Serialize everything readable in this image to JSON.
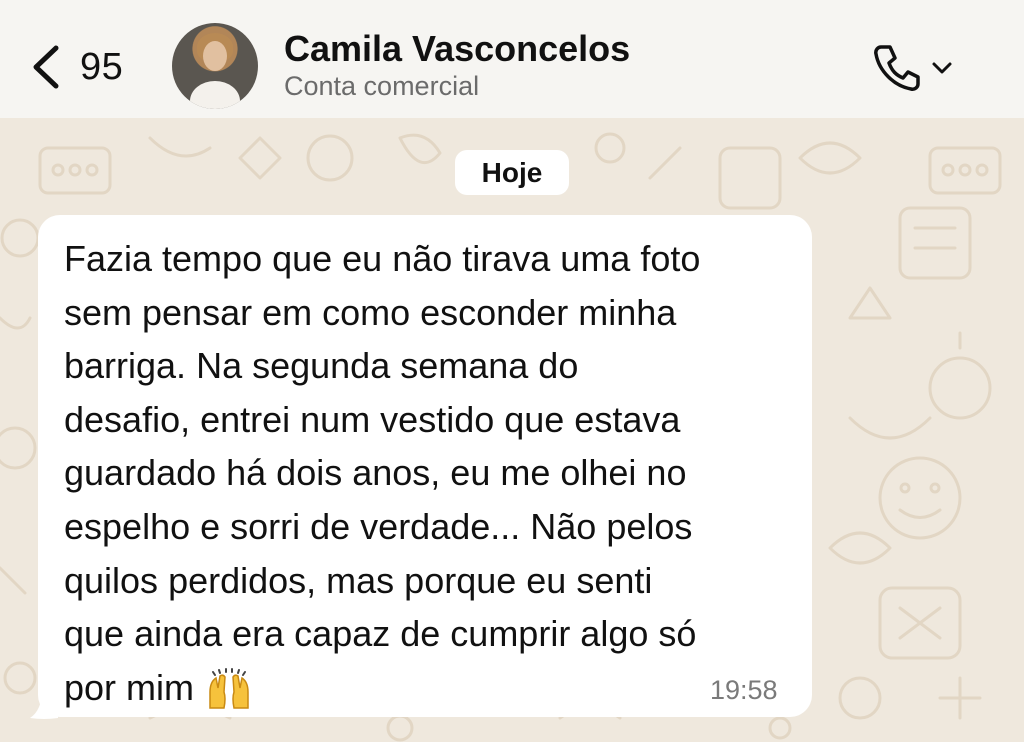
{
  "header": {
    "back_count": "95",
    "contact_name": "Camila Vasconcelos",
    "contact_subtitle": "Conta comercial",
    "back_icon": "chevron-left-icon",
    "call_icon": "phone-icon",
    "call_menu_icon": "chevron-down-icon"
  },
  "chat": {
    "date_label": "Hoje",
    "message": {
      "lines": [
        "Fazia tempo que eu não tirava uma foto",
        "sem pensar em como esconder minha",
        "barriga. Na segunda semana do",
        "desafio, entrei num vestido que estava",
        "guardado há dois anos, eu me olhei no",
        "espelho e sorri de verdade... Não pelos",
        "quilos perdidos, mas porque eu senti",
        "que ainda era capaz de cumprir algo só",
        "por mim"
      ],
      "emoji": "raising-hands-emoji",
      "time": "19:58"
    }
  },
  "colors": {
    "header_bg": "#f6f5f2",
    "chat_bg": "#efe8dd",
    "bubble_bg": "#ffffff",
    "text": "#111111",
    "muted": "#6b6b6b"
  }
}
